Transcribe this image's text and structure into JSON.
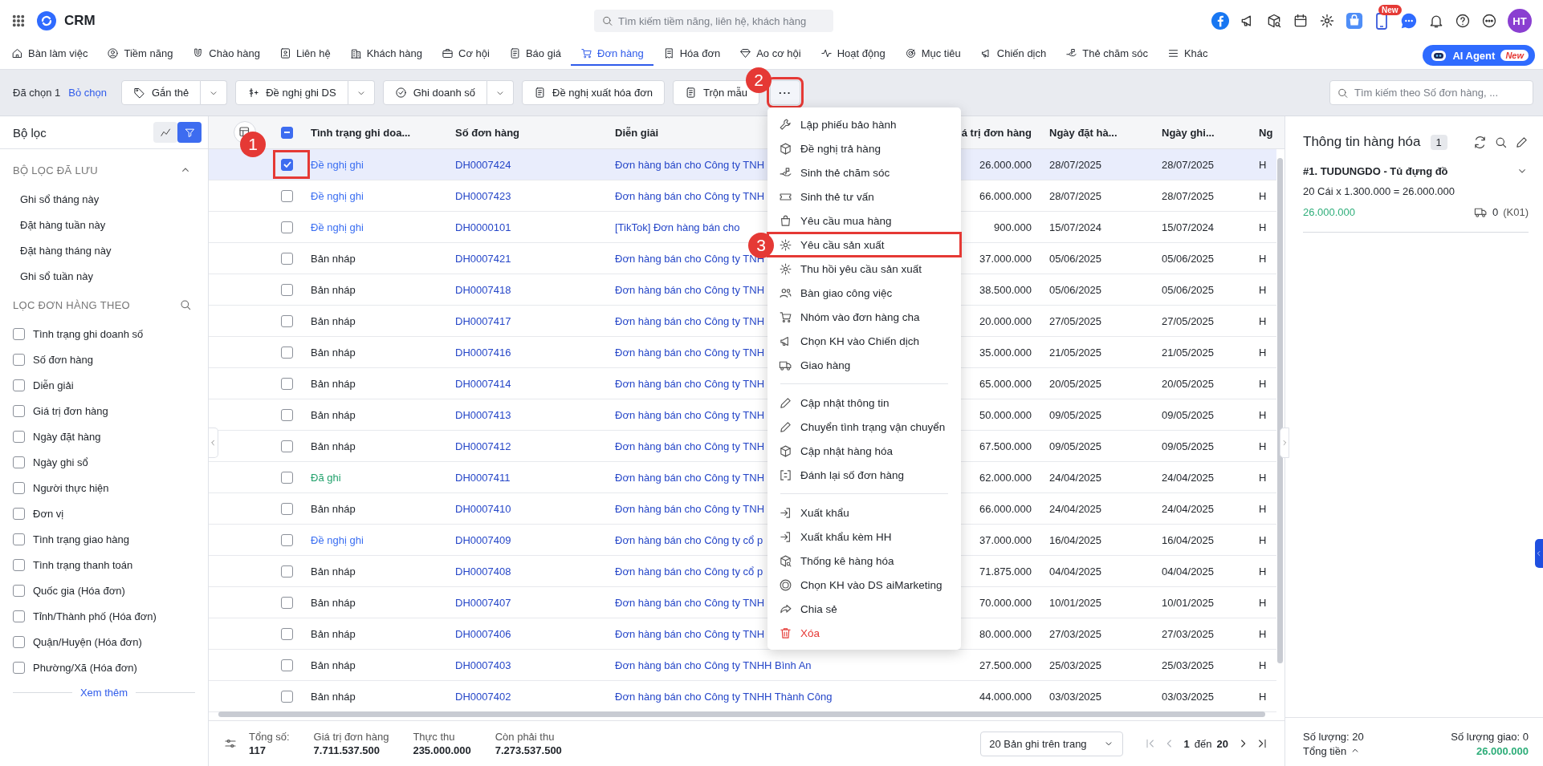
{
  "app": {
    "name": "CRM"
  },
  "top_search": {
    "placeholder": "Tìm kiếm tiềm năng, liên hệ, khách hàng"
  },
  "header": {
    "new_badge": "New",
    "avatar": "HT"
  },
  "nav": [
    {
      "label": "Bàn làm việc",
      "selected": false
    },
    {
      "label": "Tiềm năng",
      "selected": false
    },
    {
      "label": "Chào hàng",
      "selected": false
    },
    {
      "label": "Liên hệ",
      "selected": false
    },
    {
      "label": "Khách hàng",
      "selected": false
    },
    {
      "label": "Cơ hội",
      "selected": false
    },
    {
      "label": "Báo giá",
      "selected": false
    },
    {
      "label": "Đơn hàng",
      "selected": true
    },
    {
      "label": "Hóa đơn",
      "selected": false
    },
    {
      "label": "Ao cơ hội",
      "selected": false
    },
    {
      "label": "Hoạt động",
      "selected": false
    },
    {
      "label": "Mục tiêu",
      "selected": false
    },
    {
      "label": "Chiến dịch",
      "selected": false
    },
    {
      "label": "Thẻ chăm sóc",
      "selected": false
    },
    {
      "label": "Khác",
      "selected": false
    }
  ],
  "ai_agent": {
    "label": "AI Agent",
    "badge": "New"
  },
  "toolbar": {
    "selected_count": "Đã chọn 1",
    "deselect": "Bỏ chọn",
    "actions": [
      {
        "label": "Gắn thẻ",
        "split": true
      },
      {
        "label": "Đề nghị ghi DS",
        "split": true
      },
      {
        "label": "Ghi doanh số",
        "split": true
      },
      {
        "label": "Đề nghị xuất hóa đơn",
        "split": false
      },
      {
        "label": "Trộn mẫu",
        "split": false
      }
    ],
    "more": {
      "label": "···",
      "callout": "2",
      "expanded": true
    },
    "search": {
      "placeholder": "Tìm kiếm theo Số đơn hàng, ..."
    }
  },
  "menu_groups": [
    {
      "items": [
        {
          "label": "Lập phiếu bảo hành",
          "kind": "action"
        },
        {
          "label": "Đề nghị trả hàng",
          "kind": "action"
        },
        {
          "label": "Sinh thẻ chăm sóc",
          "kind": "action"
        },
        {
          "label": "Sinh thẻ tư vấn",
          "kind": "action"
        },
        {
          "label": "Yêu cầu mua hàng",
          "kind": "action"
        },
        {
          "label": "Yêu cầu sản xuất",
          "kind": "action",
          "callout": "3"
        },
        {
          "label": "Thu hồi yêu cầu sản xuất",
          "kind": "action"
        },
        {
          "label": "Bàn giao công việc",
          "kind": "action"
        },
        {
          "label": "Nhóm vào đơn hàng cha",
          "kind": "action"
        },
        {
          "label": "Chọn KH vào Chiến dịch",
          "kind": "action"
        },
        {
          "label": "Giao hàng",
          "kind": "action"
        }
      ]
    },
    {
      "items": [
        {
          "label": "Cập nhật thông tin",
          "kind": "action"
        },
        {
          "label": "Chuyển tình trạng vận chuyển",
          "kind": "action"
        },
        {
          "label": "Cập nhật hàng hóa",
          "kind": "action"
        },
        {
          "label": "Đánh lại số đơn hàng",
          "kind": "action"
        }
      ]
    },
    {
      "items": [
        {
          "label": "Xuất khẩu",
          "kind": "action"
        },
        {
          "label": "Xuất khẩu kèm HH",
          "kind": "action"
        },
        {
          "label": "Thống kê hàng hóa",
          "kind": "action"
        },
        {
          "label": "Chọn KH vào DS aiMarketing",
          "kind": "action"
        },
        {
          "label": "Chia sẻ",
          "kind": "action"
        },
        {
          "label": "Xóa",
          "kind": "danger"
        }
      ]
    }
  ],
  "sidebar": {
    "title": "Bộ lọc",
    "toggles": [
      {
        "selected": false
      },
      {
        "selected": true
      }
    ],
    "saved_title": "BỘ LỌC ĐÃ LƯU",
    "saved_expanded": true,
    "saved": [
      "Ghi sổ tháng này",
      "Đặt hàng tuần này",
      "Đặt hàng tháng này",
      "Ghi sổ tuần này"
    ],
    "filter_title": "LỌC ĐƠN HÀNG THEO",
    "filters": [
      {
        "label": "Tình trạng ghi doanh số",
        "checked": false
      },
      {
        "label": "Số đơn hàng",
        "checked": false
      },
      {
        "label": "Diễn giải",
        "checked": false
      },
      {
        "label": "Giá trị đơn hàng",
        "checked": false
      },
      {
        "label": "Ngày đặt hàng",
        "checked": false
      },
      {
        "label": "Ngày ghi sổ",
        "checked": false
      },
      {
        "label": "Người thực hiện",
        "checked": false
      },
      {
        "label": "Đơn vị",
        "checked": false
      },
      {
        "label": "Tình trạng giao hàng",
        "checked": false
      },
      {
        "label": "Tình trạng thanh toán",
        "checked": false
      },
      {
        "label": "Quốc gia (Hóa đơn)",
        "checked": false
      },
      {
        "label": "Tỉnh/Thành phố (Hóa đơn)",
        "checked": false
      },
      {
        "label": "Quận/Huyện (Hóa đơn)",
        "checked": false
      },
      {
        "label": "Phường/Xã (Hóa đơn)",
        "checked": false
      }
    ],
    "more": "Xem thêm"
  },
  "table": {
    "select_all": {
      "indeterminate": true
    },
    "columns": [
      "Tình trạng ghi doa...",
      "Số đơn hàng",
      "Diễn giải",
      "á trị đơn hàng",
      "Ngày đặt hà...",
      "Ngày ghi...",
      "Ng"
    ],
    "rows": [
      {
        "selected": true,
        "checked": true,
        "callout": "1",
        "status": {
          "label": "Đề nghị ghi",
          "color": "#3a6ef2"
        },
        "number": "DH0007424",
        "description": "Đơn hàng bán cho Công ty TNH",
        "value": "26.000.000",
        "order_date": "28/07/2025",
        "record_date": "28/07/2025",
        "column_7": "H"
      },
      {
        "selected": false,
        "checked": false,
        "status": {
          "label": "Đề nghị ghi",
          "color": "#3a6ef2"
        },
        "number": "DH0007423",
        "description": "Đơn hàng bán cho Công ty TNH",
        "value": "66.000.000",
        "order_date": "28/07/2025",
        "record_date": "28/07/2025",
        "column_7": "H"
      },
      {
        "selected": false,
        "checked": false,
        "status": {
          "label": "Đề nghị ghi",
          "color": "#3a6ef2"
        },
        "number": "DH0000101",
        "description": "[TikTok] Đơn hàng bán cho",
        "value": "900.000",
        "order_date": "15/07/2024",
        "record_date": "15/07/2024",
        "column_7": "H"
      },
      {
        "selected": false,
        "checked": false,
        "status": {
          "label": "Bản nháp",
          "color": "#1f2329"
        },
        "number": "DH0007421",
        "description": "Đơn hàng bán cho Công ty TNH",
        "value": "37.000.000",
        "order_date": "05/06/2025",
        "record_date": "05/06/2025",
        "column_7": "H"
      },
      {
        "selected": false,
        "checked": false,
        "status": {
          "label": "Bản nháp",
          "color": "#1f2329"
        },
        "number": "DH0007418",
        "description": "Đơn hàng bán cho Công ty TNH",
        "value": "38.500.000",
        "order_date": "05/06/2025",
        "record_date": "05/06/2025",
        "column_7": "H"
      },
      {
        "selected": false,
        "checked": false,
        "status": {
          "label": "Bản nháp",
          "color": "#1f2329"
        },
        "number": "DH0007417",
        "description": "Đơn hàng bán cho Công ty TNH",
        "value": "20.000.000",
        "order_date": "27/05/2025",
        "record_date": "27/05/2025",
        "column_7": "H"
      },
      {
        "selected": false,
        "checked": false,
        "status": {
          "label": "Bản nháp",
          "color": "#1f2329"
        },
        "number": "DH0007416",
        "description": "Đơn hàng bán cho Công ty TNH",
        "value": "35.000.000",
        "order_date": "21/05/2025",
        "record_date": "21/05/2025",
        "column_7": "H"
      },
      {
        "selected": false,
        "checked": false,
        "status": {
          "label": "Bản nháp",
          "color": "#1f2329"
        },
        "number": "DH0007414",
        "description": "Đơn hàng bán cho Công ty TNH",
        "value": "65.000.000",
        "order_date": "20/05/2025",
        "record_date": "20/05/2025",
        "column_7": "H"
      },
      {
        "selected": false,
        "checked": false,
        "status": {
          "label": "Bản nháp",
          "color": "#1f2329"
        },
        "number": "DH0007413",
        "description": "Đơn hàng bán cho Công ty TNH",
        "value": "50.000.000",
        "order_date": "09/05/2025",
        "record_date": "09/05/2025",
        "column_7": "H"
      },
      {
        "selected": false,
        "checked": false,
        "status": {
          "label": "Bản nháp",
          "color": "#1f2329"
        },
        "number": "DH0007412",
        "description": "Đơn hàng bán cho Công ty TNH",
        "value": "67.500.000",
        "order_date": "09/05/2025",
        "record_date": "09/05/2025",
        "column_7": "H"
      },
      {
        "selected": false,
        "checked": false,
        "status": {
          "label": "Đã ghi",
          "color": "#23a26d"
        },
        "number": "DH0007411",
        "description": "Đơn hàng bán cho Công ty TNH",
        "value": "62.000.000",
        "order_date": "24/04/2025",
        "record_date": "24/04/2025",
        "column_7": "H"
      },
      {
        "selected": false,
        "checked": false,
        "status": {
          "label": "Bản nháp",
          "color": "#1f2329"
        },
        "number": "DH0007410",
        "description": "Đơn hàng bán cho Công ty TNH",
        "value": "66.000.000",
        "order_date": "24/04/2025",
        "record_date": "24/04/2025",
        "column_7": "H"
      },
      {
        "selected": false,
        "checked": false,
        "status": {
          "label": "Đề nghị ghi",
          "color": "#3a6ef2"
        },
        "number": "DH0007409",
        "description": "Đơn hàng bán cho Công ty cổ p",
        "value": "37.000.000",
        "order_date": "16/04/2025",
        "record_date": "16/04/2025",
        "column_7": "H"
      },
      {
        "selected": false,
        "checked": false,
        "status": {
          "label": "Bản nháp",
          "color": "#1f2329"
        },
        "number": "DH0007408",
        "description": "Đơn hàng bán cho Công ty cổ p",
        "value": "71.875.000",
        "order_date": "04/04/2025",
        "record_date": "04/04/2025",
        "column_7": "H"
      },
      {
        "selected": false,
        "checked": false,
        "status": {
          "label": "Bản nháp",
          "color": "#1f2329"
        },
        "number": "DH0007407",
        "description": "Đơn hàng bán cho Công ty TNH",
        "value": "70.000.000",
        "order_date": "10/01/2025",
        "record_date": "10/01/2025",
        "column_7": "H"
      },
      {
        "selected": false,
        "checked": false,
        "status": {
          "label": "Bản nháp",
          "color": "#1f2329"
        },
        "number": "DH0007406",
        "description": "Đơn hàng bán cho Công ty TNH",
        "value": "80.000.000",
        "order_date": "27/03/2025",
        "record_date": "27/03/2025",
        "column_7": "H"
      },
      {
        "selected": false,
        "checked": false,
        "status": {
          "label": "Bản nháp",
          "color": "#1f2329"
        },
        "number": "DH0007403",
        "description": "Đơn hàng bán cho Công ty TNHH Bình An",
        "value": "27.500.000",
        "order_date": "25/03/2025",
        "record_date": "25/03/2025",
        "column_7": "H"
      },
      {
        "selected": false,
        "checked": false,
        "status": {
          "label": "Bản nháp",
          "color": "#1f2329"
        },
        "number": "DH0007402",
        "description": "Đơn hàng bán cho Công ty TNHH Thành Công",
        "value": "44.000.000",
        "order_date": "03/03/2025",
        "record_date": "03/03/2025",
        "column_7": "H"
      }
    ],
    "totals": [
      {
        "label": "Tổng số:",
        "value": "117"
      },
      {
        "label": "Giá trị đơn hàng",
        "value": "7.711.537.500"
      },
      {
        "label": "Thực thu",
        "value": "235.000.000"
      },
      {
        "label": "Còn phải thu",
        "value": "7.273.537.500"
      }
    ],
    "pager": {
      "page_size": "20 Bản ghi trên trang",
      "page": "1",
      "to": "đến",
      "last": "20"
    }
  },
  "goods_panel": {
    "title": "Thông tin hàng hóa",
    "count": "1",
    "items": [
      {
        "title": "#1. TUDUNGDO - Tủ đựng đồ",
        "line": "20 Cái x 1.300.000 = 26.000.000",
        "amount": "26.000.000",
        "delivered": "0",
        "warehouse": "(K01)"
      }
    ],
    "summary": {
      "qty": "Số lượng: 20",
      "delivered": "Số lượng giao: 0",
      "total_label": "Tổng tiền",
      "total": "26.000.000"
    }
  }
}
